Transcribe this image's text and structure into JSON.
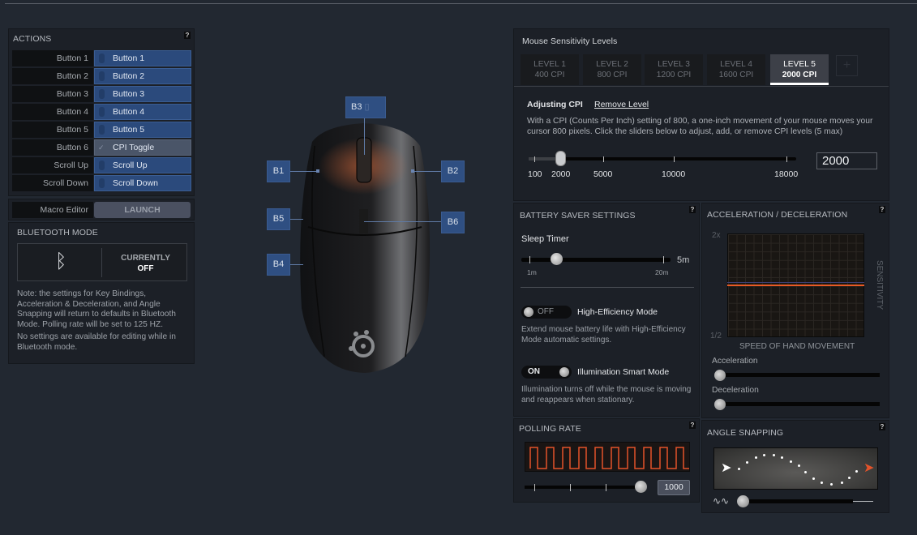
{
  "actions": {
    "title": "ACTIONS",
    "help": "?",
    "rows": [
      {
        "label": "Button 1",
        "binding": "Button 1",
        "icon": "mouse-icon"
      },
      {
        "label": "Button 2",
        "binding": "Button 2",
        "icon": "mouse-icon"
      },
      {
        "label": "Button 3",
        "binding": "Button 3",
        "icon": "mouse-icon"
      },
      {
        "label": "Button 4",
        "binding": "Button 4",
        "icon": "mouse-icon"
      },
      {
        "label": "Button 5",
        "binding": "Button 5",
        "icon": "mouse-icon"
      },
      {
        "label": "Button 6",
        "binding": "CPI Toggle",
        "icon": "cpi-toggle-icon"
      },
      {
        "label": "Scroll Up",
        "binding": "Scroll Up",
        "icon": "mouse-icon"
      },
      {
        "label": "Scroll Down",
        "binding": "Scroll Down",
        "icon": "mouse-icon"
      }
    ],
    "macro_label": "Macro Editor",
    "launch_label": "LAUNCH"
  },
  "bluetooth": {
    "title": "BLUETOOTH MODE",
    "icon_glyph": "ᛒ",
    "currently_label": "CURRENTLY",
    "state": "OFF",
    "note1": "Note: the settings for Key Bindings, Acceleration & Deceleration, and Angle Snapping will return to defaults in Bluetooth Mode. Polling rate will be set to 125 HZ.",
    "note2": "No settings are available for editing while in Bluetooth mode."
  },
  "mouse_labels": {
    "b1": "B1",
    "b2": "B2",
    "b3": "B3",
    "b4": "B4",
    "b5": "B5",
    "b6": "B6"
  },
  "sensitivity": {
    "title": "Mouse Sensitivity Levels",
    "levels": [
      {
        "name": "LEVEL 1",
        "cpi": "400 CPI"
      },
      {
        "name": "LEVEL 2",
        "cpi": "800 CPI"
      },
      {
        "name": "LEVEL 3",
        "cpi": "1200 CPI"
      },
      {
        "name": "LEVEL 4",
        "cpi": "1600 CPI"
      },
      {
        "name": "LEVEL 5",
        "cpi": "2000 CPI"
      }
    ],
    "active_level": 5,
    "add_label": "+",
    "adjusting_label": "Adjusting CPI",
    "remove_label": "Remove Level",
    "description": "With a CPI (Counts Per Inch) setting of 800, a one-inch movement of your mouse moves your cursor 800 pixels. Click the sliders below to adjust, add, or remove CPI levels (5 max)",
    "slider_ticks": [
      "100",
      "2000",
      "5000",
      "10000",
      "18000"
    ],
    "slider_value": 2000,
    "value_input": "2000"
  },
  "battery": {
    "title": "BATTERY SAVER SETTINGS",
    "help": "?",
    "sleep_label": "Sleep Timer",
    "sleep_value": "5m",
    "sleep_min": "1m",
    "sleep_max": "20m",
    "high_eff_state": "OFF",
    "high_eff_label": "High-Efficiency Mode",
    "high_eff_desc": "Extend mouse battery life with High-Efficiency Mode automatic settings.",
    "illum_state": "ON",
    "illum_label": "Illumination Smart Mode",
    "illum_desc": "Illumination turns off while the mouse is moving and reappears when stationary."
  },
  "polling": {
    "title": "POLLING RATE",
    "help": "?",
    "value": "1000"
  },
  "accel": {
    "title": "ACCELERATION / DECELERATION",
    "help": "?",
    "y_top": "2x",
    "y_bottom": "1/2",
    "y_axis": "SENSITIVITY",
    "x_axis": "SPEED OF HAND MOVEMENT",
    "accel_label": "Acceleration",
    "decel_label": "Deceleration",
    "accel_value": 0,
    "decel_value": 0
  },
  "angle": {
    "title": "ANGLE SNAPPING",
    "help": "?",
    "value": 0
  },
  "colors": {
    "background": "#222831",
    "panel": "#1c2027",
    "binding_blue": "#2b4a7c",
    "accent_orange": "#e85a25"
  }
}
